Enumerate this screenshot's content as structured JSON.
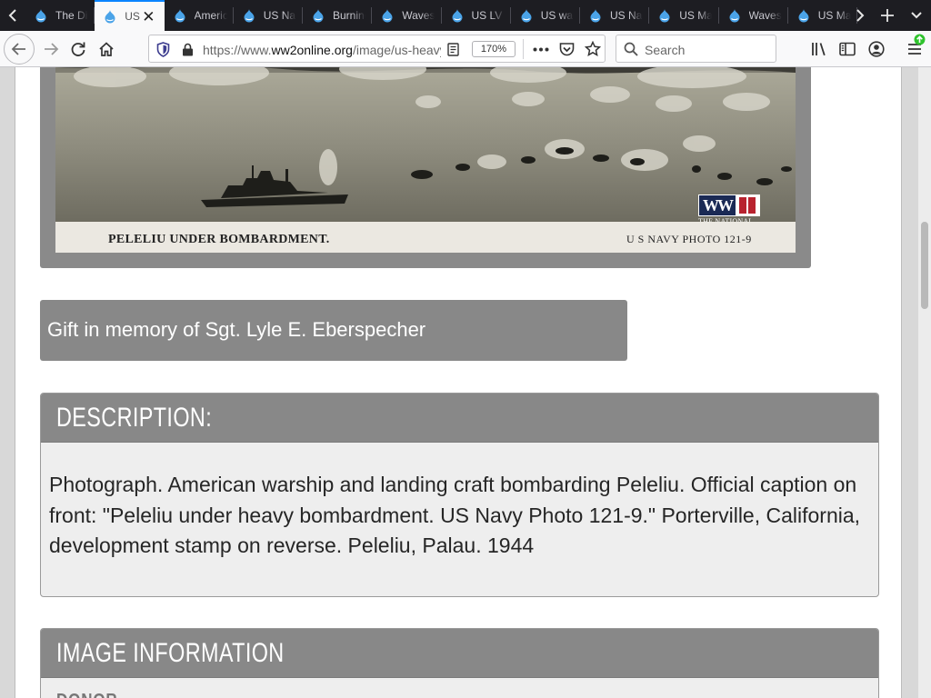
{
  "browser": {
    "tabs": [
      {
        "title": "The Dig",
        "active": false
      },
      {
        "title": "US",
        "active": true
      },
      {
        "title": "American",
        "active": false
      },
      {
        "title": "US Na",
        "active": false
      },
      {
        "title": "Burning",
        "active": false
      },
      {
        "title": "Waves",
        "active": false
      },
      {
        "title": "US LV",
        "active": false
      },
      {
        "title": "US wa",
        "active": false
      },
      {
        "title": "US Na",
        "active": false
      },
      {
        "title": "US Ma",
        "active": false
      },
      {
        "title": "Waves",
        "active": false
      },
      {
        "title": "US Ma",
        "active": false
      }
    ],
    "url_prefix": "https://www.",
    "url_domain": "ww2online.org",
    "url_path": "/image/us-heavy",
    "zoom": "170%",
    "search_placeholder": "Search",
    "accent_color": "#0a84ff"
  },
  "page": {
    "photo": {
      "caption_left": "PELELIU UNDER BOMBARDMENT.",
      "caption_right": "U S NAVY PHOTO 121-9",
      "logo_text": "WWII",
      "logo_sub": "THE NATIONAL WWII MUSEUM"
    },
    "gift_text": "Gift in memory of Sgt. Lyle E. Eberspecher",
    "description": {
      "heading": "DESCRIPTION:",
      "body": "Photograph. American warship and landing craft bombarding Peleliu. Official caption on front: \"Peleliu under heavy bombardment. US Navy Photo 121-9.\" Porterville, California, development stamp on reverse. Peleliu, Palau. 1944"
    },
    "image_information": {
      "heading": "IMAGE INFORMATION",
      "first_label": "DONOR"
    }
  }
}
